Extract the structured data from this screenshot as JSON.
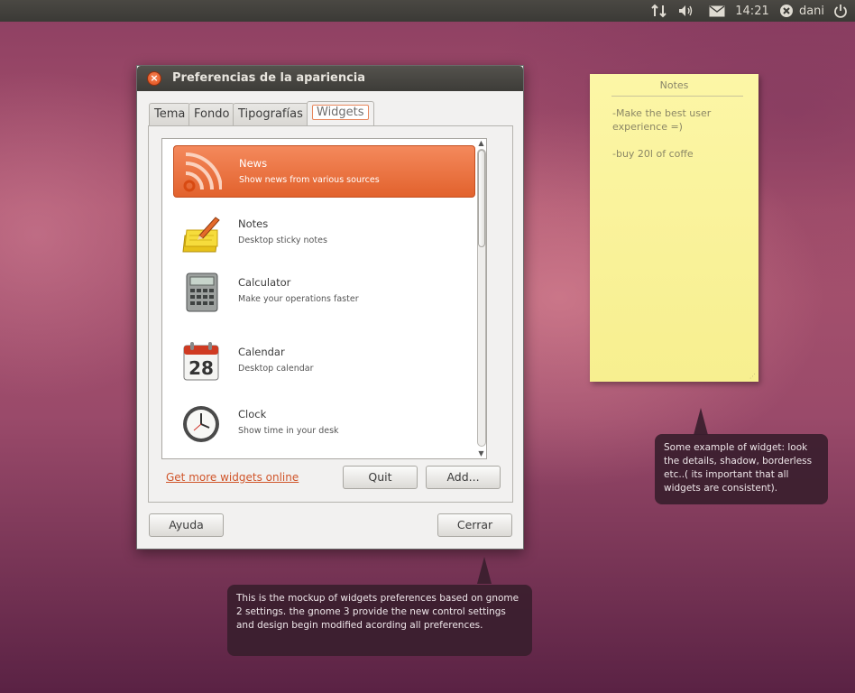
{
  "top_panel": {
    "clock": "14:21",
    "user": "dani",
    "icons": [
      "network-arrows-icon",
      "volume-icon",
      "mail-icon",
      "user-status-icon",
      "power-icon"
    ]
  },
  "window": {
    "title": "Preferencias de la apariencia",
    "tabs": [
      {
        "label": "Tema",
        "active": false
      },
      {
        "label": "Fondo",
        "active": false
      },
      {
        "label": "Tipografías",
        "active": false
      },
      {
        "label": "Widgets",
        "active": true
      }
    ],
    "widgets": [
      {
        "title": "News",
        "description": "Show news from various sources",
        "icon": "rss-icon",
        "selected": true
      },
      {
        "title": "Notes",
        "description": "Desktop sticky notes",
        "icon": "notepad-icon",
        "selected": false
      },
      {
        "title": "Calculator",
        "description": "Make your operations faster",
        "icon": "calculator-icon",
        "selected": false
      },
      {
        "title": "Calendar",
        "description": "Desktop calendar",
        "icon": "calendar-icon",
        "icon_text": "28",
        "selected": false
      },
      {
        "title": "Clock",
        "description": "Show time in your desk",
        "icon": "clock-icon",
        "selected": false
      }
    ],
    "get_more_link": "Get more widgets online",
    "quit_label": "Quit",
    "add_label": "Add...",
    "help_label": "Ayuda",
    "close_label": "Cerrar"
  },
  "notes_widget": {
    "title": "Notes",
    "lines": [
      "-Make the best user experience =)",
      "-buy 20l of coffe"
    ]
  },
  "callouts": {
    "widget_note": "Some example of widget: look the details, shadow, borderless etc..( its important that all widgets are consistent).",
    "prefs_note": "This is the mockup of widgets preferences based on gnome 2 settings. the gnome 3 provide the new control settings and design begin modified acording all preferences."
  },
  "colors": {
    "accent": "#e86a35",
    "panel": "#3c3b37",
    "note_bg": "#faf39e"
  }
}
